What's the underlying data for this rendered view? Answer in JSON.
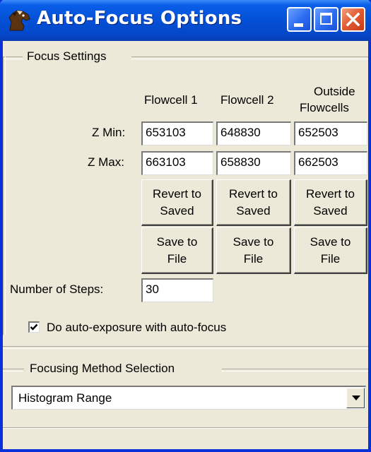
{
  "window": {
    "title": "Auto-Focus Options",
    "icon": "horse-head-icon",
    "controls": [
      "minimize",
      "maximize",
      "close"
    ]
  },
  "focus_settings": {
    "group_label": "Focus Settings",
    "columns": [
      {
        "label": "Flowcell 1"
      },
      {
        "label": "Flowcell 2"
      },
      {
        "label_line1": "Outside",
        "label_line2": "Flowcells"
      }
    ],
    "z_min": {
      "label": "Z Min:",
      "values": [
        "653103",
        "648830",
        "652503"
      ]
    },
    "z_max": {
      "label": "Z Max:",
      "values": [
        "663103",
        "658830",
        "662503"
      ]
    },
    "revert_button": {
      "line1": "Revert to",
      "line2": "Saved"
    },
    "save_button": {
      "line1": "Save to",
      "line2": "File"
    },
    "steps": {
      "label": "Number of Steps:",
      "value": "30"
    },
    "auto_exposure": {
      "label": "Do auto-exposure with auto-focus",
      "checked": true
    }
  },
  "focusing_method": {
    "group_label": "Focusing Method Selection",
    "selected": "Histogram Range"
  },
  "colors": {
    "titlebar": "#0450d6",
    "close_button": "#e05a30",
    "dialog_background": "#ece9d8"
  }
}
